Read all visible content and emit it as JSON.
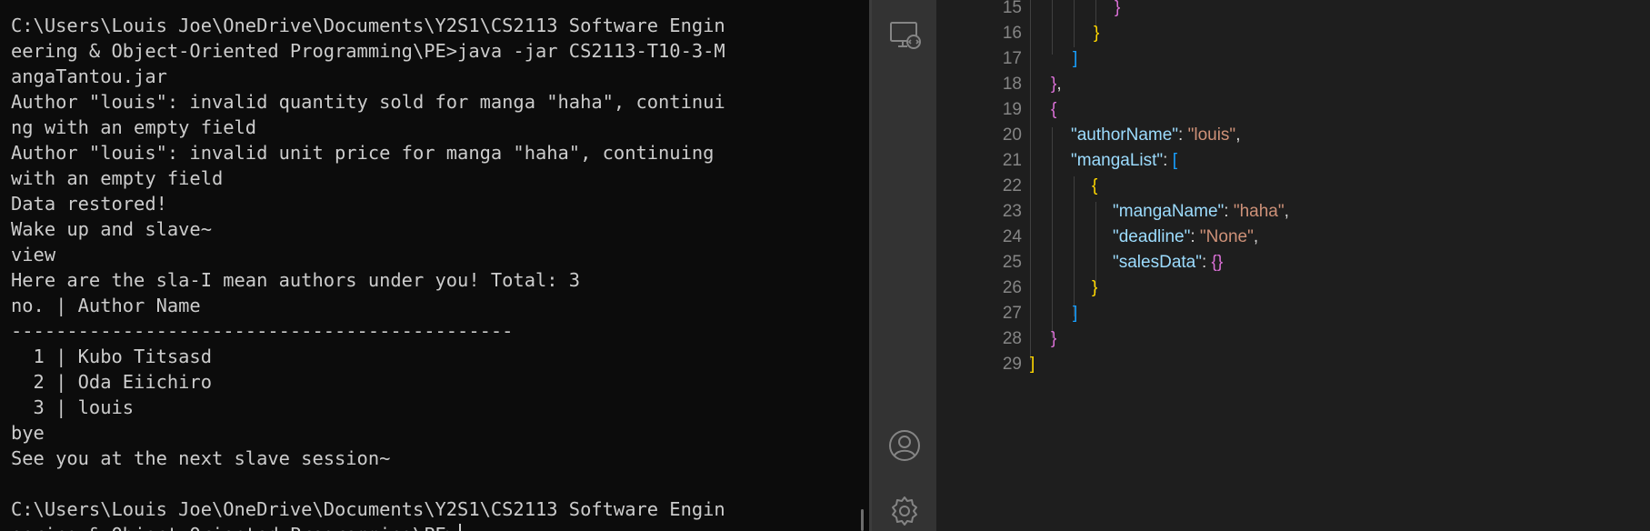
{
  "terminal": {
    "lines": [
      "C:\\Users\\Louis Joe\\OneDrive\\Documents\\Y2S1\\CS2113 Software Engin",
      "eering & Object-Oriented Programming\\PE>java -jar CS2113-T10-3-M",
      "angaTantou.jar",
      "Author \"louis\": invalid quantity sold for manga \"haha\", continui",
      "ng with an empty field",
      "Author \"louis\": invalid unit price for manga \"haha\", continuing",
      "with an empty field",
      "Data restored!",
      "Wake up and slave~",
      "view",
      "Here are the sla-I mean authors under you! Total: 3",
      "no. | Author Name",
      "---------------------------------------------",
      "  1 | Kubo Titsasd",
      "  2 | Oda Eiichiro",
      "  3 | louis",
      "bye",
      "See you at the next slave session~",
      "",
      "C:\\Users\\Louis Joe\\OneDrive\\Documents\\Y2S1\\CS2113 Software Engin",
      "eering & Object-Oriented Programming\\PE>"
    ]
  },
  "activity_bar": {
    "icons": [
      "remote-explorer-icon",
      "account-icon",
      "settings-gear-icon"
    ]
  },
  "editor": {
    "line_numbers": [
      "15",
      "16",
      "17",
      "18",
      "19",
      "20",
      "21",
      "22",
      "23",
      "24",
      "25",
      "26",
      "27",
      "28",
      "29"
    ],
    "tokens": {
      "l15": "}",
      "l16": "}",
      "l17": "]",
      "l18_brace": "}",
      "l18_comma": ",",
      "l19": "{",
      "l20_key": "\"authorName\"",
      "l20_colon": ": ",
      "l20_val": "\"louis\"",
      "l20_comma": ",",
      "l21_key": "\"mangaList\"",
      "l21_colon": ": ",
      "l21_bracket": "[",
      "l22": "{",
      "l23_key": "\"mangaName\"",
      "l23_colon": ": ",
      "l23_val": "\"haha\"",
      "l23_comma": ",",
      "l24_key": "\"deadline\"",
      "l24_colon": ": ",
      "l24_val": "\"None\"",
      "l24_comma": ",",
      "l25_key": "\"salesData\"",
      "l25_colon": ": ",
      "l25_val": "{}",
      "l26": "}",
      "l27": "]",
      "l28": "}",
      "l29": "]"
    }
  },
  "colors": {
    "terminal_bg": "#0c0c0c",
    "terminal_fg": "#cccccc",
    "editor_bg": "#1e1e1e",
    "activity_bar_bg": "#333333",
    "json_key": "#9cdcfe",
    "json_string": "#ce9178",
    "bracket_gold": "#ffd700",
    "bracket_orchid": "#da70d6",
    "bracket_blue": "#179fff",
    "line_number": "#858585"
  }
}
